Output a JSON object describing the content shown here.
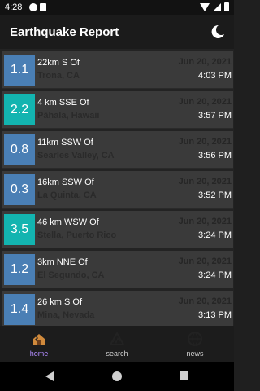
{
  "status_bar": {
    "time": "4:28"
  },
  "app_bar": {
    "title": "Earthquake Report",
    "theme_icon": "moon-icon"
  },
  "earthquakes": [
    {
      "mag": "1.1",
      "color": "#4a7fb5",
      "offset": "22km S  Of",
      "place": "Trona, CA",
      "date": "Jun 20, 2021",
      "time": "4:03 PM"
    },
    {
      "mag": "2.2",
      "color": "#13b4b0",
      "offset": "4 km SSE  Of",
      "place": "Pāhala, Hawaii",
      "date": "Jun 20, 2021",
      "time": "3:57 PM"
    },
    {
      "mag": "0.8",
      "color": "#4a7fb5",
      "offset": "11km SSW  Of",
      "place": "Searles Valley, CA",
      "date": "Jun 20, 2021",
      "time": "3:56 PM"
    },
    {
      "mag": "0.3",
      "color": "#4a7fb5",
      "offset": "16km SSW  Of",
      "place": "La Quinta, CA",
      "date": "Jun 20, 2021",
      "time": "3:52 PM"
    },
    {
      "mag": "3.5",
      "color": "#13b4b0",
      "offset": "46 km WSW  Of",
      "place": "Stella, Puerto Rico",
      "date": "Jun 20, 2021",
      "time": "3:24 PM"
    },
    {
      "mag": "1.2",
      "color": "#4a7fb5",
      "offset": "3km NNE  Of",
      "place": "El Segundo, CA",
      "date": "Jun 20, 2021",
      "time": "3:24 PM"
    },
    {
      "mag": "1.4",
      "color": "#4a7fb5",
      "offset": "26 km S  Of",
      "place": "Mina, Nevada",
      "date": "Jun 20, 2021",
      "time": "3:13 PM"
    }
  ],
  "bottom_nav": [
    {
      "label": "home",
      "icon": "earthquake-house-icon",
      "active": true
    },
    {
      "label": "search",
      "icon": "seismograph-icon",
      "active": false
    },
    {
      "label": "news",
      "icon": "globe-news-icon",
      "active": false
    }
  ],
  "colors": {
    "accent": "#b28cff",
    "mag_low": "#4a7fb5",
    "mag_mid": "#13b4b0"
  }
}
